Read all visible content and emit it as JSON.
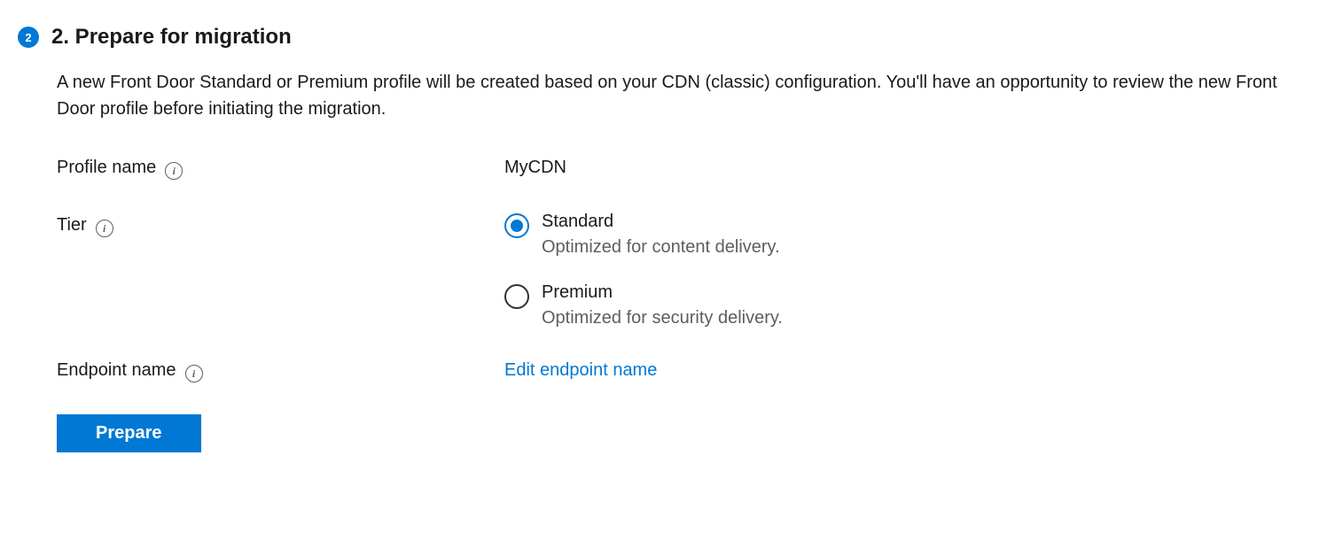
{
  "step": {
    "number": "2",
    "title": "2. Prepare for migration",
    "description": "A new Front Door Standard or Premium profile will be created based on your CDN (classic) configuration. You'll have an opportunity to review the new Front Door profile before initiating the migration."
  },
  "form": {
    "profileName": {
      "label": "Profile name",
      "value": "MyCDN"
    },
    "tier": {
      "label": "Tier",
      "options": [
        {
          "label": "Standard",
          "description": "Optimized for content delivery.",
          "selected": true
        },
        {
          "label": "Premium",
          "description": "Optimized for security delivery.",
          "selected": false
        }
      ]
    },
    "endpointName": {
      "label": "Endpoint name",
      "linkText": "Edit endpoint name"
    }
  },
  "actions": {
    "prepare": "Prepare"
  },
  "icons": {
    "info": "i"
  }
}
